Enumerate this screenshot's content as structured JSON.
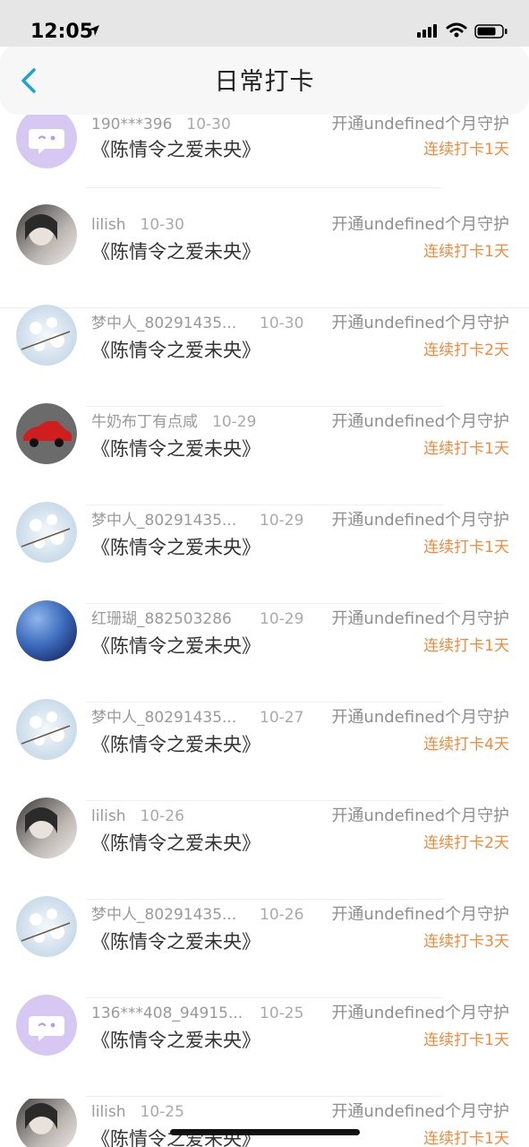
{
  "status_bar": {
    "time": "12:05"
  },
  "nav": {
    "title": "日常打卡",
    "back_icon": "chevron-left-icon"
  },
  "colors": {
    "accent": "#1aa3d9",
    "streak": "#f08a3c",
    "avatar_bot": "#d7c8f3"
  },
  "entries": [
    {
      "user": "190***396",
      "date": "10-30",
      "title": "《陈情令之爱未央》",
      "guard": "开通undefined个月守护",
      "streak": "连续打卡1天",
      "avatar": "bot-avatar-icon"
    },
    {
      "user": "lilish",
      "date": "10-30",
      "title": "《陈情令之爱未央》",
      "guard": "开通undefined个月守护",
      "streak": "连续打卡1天",
      "avatar": "girl-photo-avatar"
    },
    {
      "user": "梦中人_80291435...",
      "date": "10-30",
      "title": "《陈情令之爱未央》",
      "guard": "开通undefined个月守护",
      "streak": "连续打卡2天",
      "avatar": "flower-photo-avatar"
    },
    {
      "user": "牛奶布丁有点咸",
      "date": "10-29",
      "title": "《陈情令之爱未央》",
      "guard": "开通undefined个月守护",
      "streak": "连续打卡1天",
      "avatar": "car-photo-avatar"
    },
    {
      "user": "梦中人_80291435...",
      "date": "10-29",
      "title": "《陈情令之爱未央》",
      "guard": "开通undefined个月守护",
      "streak": "连续打卡1天",
      "avatar": "flower-photo-avatar"
    },
    {
      "user": "红珊瑚_882503286",
      "date": "10-29",
      "title": "《陈情令之爱未央》",
      "guard": "开通undefined个月守护",
      "streak": "连续打卡1天",
      "avatar": "sky-photo-avatar"
    },
    {
      "user": "梦中人_80291435...",
      "date": "10-27",
      "title": "《陈情令之爱未央》",
      "guard": "开通undefined个月守护",
      "streak": "连续打卡4天",
      "avatar": "flower-photo-avatar"
    },
    {
      "user": "lilish",
      "date": "10-26",
      "title": "《陈情令之爱未央》",
      "guard": "开通undefined个月守护",
      "streak": "连续打卡2天",
      "avatar": "girl-photo-avatar"
    },
    {
      "user": "梦中人_80291435...",
      "date": "10-26",
      "title": "《陈情令之爱未央》",
      "guard": "开通undefined个月守护",
      "streak": "连续打卡3天",
      "avatar": "flower-photo-avatar"
    },
    {
      "user": "136***408_94915...",
      "date": "10-25",
      "title": "《陈情令之爱未央》",
      "guard": "开通undefined个月守护",
      "streak": "连续打卡1天",
      "avatar": "bot-avatar-icon"
    },
    {
      "user": "lilish",
      "date": "10-25",
      "title": "《陈情令之爱未央》",
      "guard": "开通undefined个月守护",
      "streak": "连续打卡1天",
      "avatar": "girl-photo-avatar"
    }
  ]
}
